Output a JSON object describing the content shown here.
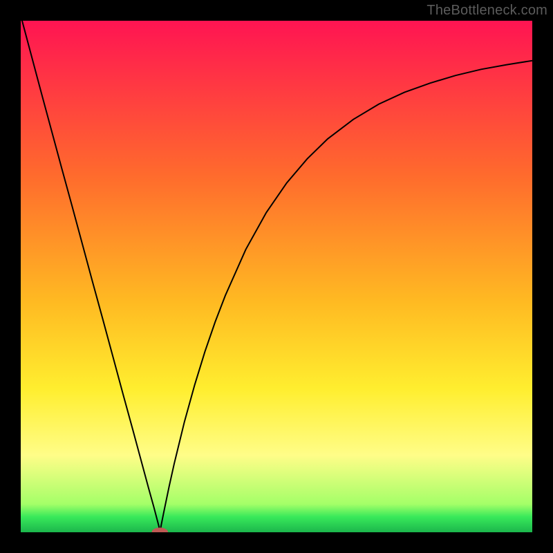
{
  "watermark": "TheBottleneck.com",
  "chart_data": {
    "type": "line",
    "title": "",
    "xlabel": "",
    "ylabel": "",
    "xlim": [
      0,
      100
    ],
    "ylim": [
      0,
      100
    ],
    "grid": false,
    "legend": false,
    "background_gradient": {
      "type": "vertical",
      "stops": [
        {
          "pos": 0.0,
          "color": "#ff1452"
        },
        {
          "pos": 0.3,
          "color": "#ff6a2d"
        },
        {
          "pos": 0.55,
          "color": "#ffba22"
        },
        {
          "pos": 0.72,
          "color": "#ffee2f"
        },
        {
          "pos": 0.85,
          "color": "#fffd88"
        },
        {
          "pos": 0.945,
          "color": "#a4ff68"
        },
        {
          "pos": 0.97,
          "color": "#38e95a"
        },
        {
          "pos": 1.0,
          "color": "#1cb64c"
        }
      ]
    },
    "marker": {
      "x": 27.2,
      "y": 0,
      "color": "#c05a55",
      "radius_x": 1.6,
      "radius_y": 0.9
    },
    "series": [
      {
        "name": "curve",
        "color": "#000000",
        "x": [
          0,
          2,
          4,
          6,
          8,
          10,
          12,
          14,
          16,
          18,
          20,
          22,
          24,
          25,
          26,
          27,
          27.2,
          27.5,
          28,
          29,
          30,
          32,
          34,
          36,
          38,
          40,
          44,
          48,
          52,
          56,
          60,
          65,
          70,
          75,
          80,
          85,
          90,
          95,
          100
        ],
        "y": [
          101,
          93.5,
          86,
          78.6,
          71.2,
          63.9,
          56.5,
          49.1,
          41.8,
          34.4,
          27.0,
          19.7,
          12.3,
          8.6,
          5.0,
          1.2,
          0.0,
          1.6,
          4.1,
          8.9,
          13.4,
          21.6,
          28.8,
          35.3,
          41.1,
          46.3,
          55.3,
          62.5,
          68.3,
          73.0,
          76.9,
          80.7,
          83.7,
          86.0,
          87.8,
          89.3,
          90.5,
          91.4,
          92.2
        ]
      }
    ]
  }
}
